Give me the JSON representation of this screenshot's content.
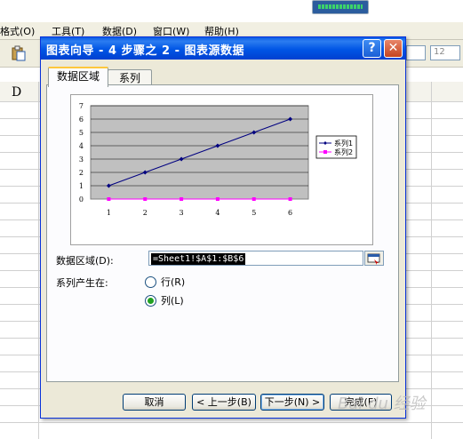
{
  "app": {
    "menu": [
      "格式(O)",
      "工具(T)",
      "数据(D)",
      "窗口(W)",
      "帮助(H)"
    ],
    "font_size": "12",
    "column_header": "D"
  },
  "dialog": {
    "title": "图表向导 - 4 步骤之 2 - 图表源数据",
    "help_label": "?",
    "close_label": "✕",
    "tabs": [
      {
        "label": "数据区域",
        "active": true
      },
      {
        "label": "系列",
        "active": false
      }
    ],
    "data_range_label": "数据区域(D):",
    "data_range_value": "=Sheet1!$A$1:$B$6",
    "series_in_label": "系列产生在:",
    "series_in_options": [
      {
        "label": "行(R)",
        "checked": false
      },
      {
        "label": "列(L)",
        "checked": true
      }
    ],
    "buttons": {
      "cancel": "取消",
      "back": "< 上一步(B)",
      "next": "下一步(N) >",
      "finish": "完成(F)"
    }
  },
  "chart_data": {
    "type": "line",
    "categories": [
      "1",
      "2",
      "3",
      "4",
      "5",
      "6"
    ],
    "series": [
      {
        "name": "系列1",
        "values": [
          1,
          2,
          3,
          4,
          5,
          6
        ],
        "color": "#000080"
      },
      {
        "name": "系列2",
        "values": [
          0,
          0,
          0,
          0,
          0,
          0
        ],
        "color": "#ff00ff"
      }
    ],
    "ylim": [
      0,
      7
    ],
    "yticks": [
      "0",
      "1",
      "2",
      "3",
      "4",
      "5",
      "6",
      "7"
    ],
    "plot_background": "#c0c0c0",
    "grid": true,
    "legend": "right"
  },
  "watermark": "Bai du 经验"
}
